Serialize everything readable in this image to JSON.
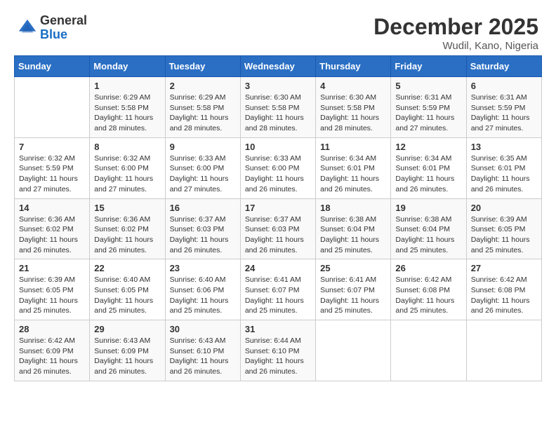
{
  "header": {
    "logo_general": "General",
    "logo_blue": "Blue",
    "month_year": "December 2025",
    "location": "Wudil, Kano, Nigeria"
  },
  "calendar": {
    "days_of_week": [
      "Sunday",
      "Monday",
      "Tuesday",
      "Wednesday",
      "Thursday",
      "Friday",
      "Saturday"
    ],
    "weeks": [
      [
        {
          "day": "",
          "info": ""
        },
        {
          "day": "1",
          "info": "Sunrise: 6:29 AM\nSunset: 5:58 PM\nDaylight: 11 hours\nand 28 minutes."
        },
        {
          "day": "2",
          "info": "Sunrise: 6:29 AM\nSunset: 5:58 PM\nDaylight: 11 hours\nand 28 minutes."
        },
        {
          "day": "3",
          "info": "Sunrise: 6:30 AM\nSunset: 5:58 PM\nDaylight: 11 hours\nand 28 minutes."
        },
        {
          "day": "4",
          "info": "Sunrise: 6:30 AM\nSunset: 5:58 PM\nDaylight: 11 hours\nand 28 minutes."
        },
        {
          "day": "5",
          "info": "Sunrise: 6:31 AM\nSunset: 5:59 PM\nDaylight: 11 hours\nand 27 minutes."
        },
        {
          "day": "6",
          "info": "Sunrise: 6:31 AM\nSunset: 5:59 PM\nDaylight: 11 hours\nand 27 minutes."
        }
      ],
      [
        {
          "day": "7",
          "info": "Sunrise: 6:32 AM\nSunset: 5:59 PM\nDaylight: 11 hours\nand 27 minutes."
        },
        {
          "day": "8",
          "info": "Sunrise: 6:32 AM\nSunset: 6:00 PM\nDaylight: 11 hours\nand 27 minutes."
        },
        {
          "day": "9",
          "info": "Sunrise: 6:33 AM\nSunset: 6:00 PM\nDaylight: 11 hours\nand 27 minutes."
        },
        {
          "day": "10",
          "info": "Sunrise: 6:33 AM\nSunset: 6:00 PM\nDaylight: 11 hours\nand 26 minutes."
        },
        {
          "day": "11",
          "info": "Sunrise: 6:34 AM\nSunset: 6:01 PM\nDaylight: 11 hours\nand 26 minutes."
        },
        {
          "day": "12",
          "info": "Sunrise: 6:34 AM\nSunset: 6:01 PM\nDaylight: 11 hours\nand 26 minutes."
        },
        {
          "day": "13",
          "info": "Sunrise: 6:35 AM\nSunset: 6:01 PM\nDaylight: 11 hours\nand 26 minutes."
        }
      ],
      [
        {
          "day": "14",
          "info": "Sunrise: 6:36 AM\nSunset: 6:02 PM\nDaylight: 11 hours\nand 26 minutes."
        },
        {
          "day": "15",
          "info": "Sunrise: 6:36 AM\nSunset: 6:02 PM\nDaylight: 11 hours\nand 26 minutes."
        },
        {
          "day": "16",
          "info": "Sunrise: 6:37 AM\nSunset: 6:03 PM\nDaylight: 11 hours\nand 26 minutes."
        },
        {
          "day": "17",
          "info": "Sunrise: 6:37 AM\nSunset: 6:03 PM\nDaylight: 11 hours\nand 26 minutes."
        },
        {
          "day": "18",
          "info": "Sunrise: 6:38 AM\nSunset: 6:04 PM\nDaylight: 11 hours\nand 25 minutes."
        },
        {
          "day": "19",
          "info": "Sunrise: 6:38 AM\nSunset: 6:04 PM\nDaylight: 11 hours\nand 25 minutes."
        },
        {
          "day": "20",
          "info": "Sunrise: 6:39 AM\nSunset: 6:05 PM\nDaylight: 11 hours\nand 25 minutes."
        }
      ],
      [
        {
          "day": "21",
          "info": "Sunrise: 6:39 AM\nSunset: 6:05 PM\nDaylight: 11 hours\nand 25 minutes."
        },
        {
          "day": "22",
          "info": "Sunrise: 6:40 AM\nSunset: 6:05 PM\nDaylight: 11 hours\nand 25 minutes."
        },
        {
          "day": "23",
          "info": "Sunrise: 6:40 AM\nSunset: 6:06 PM\nDaylight: 11 hours\nand 25 minutes."
        },
        {
          "day": "24",
          "info": "Sunrise: 6:41 AM\nSunset: 6:07 PM\nDaylight: 11 hours\nand 25 minutes."
        },
        {
          "day": "25",
          "info": "Sunrise: 6:41 AM\nSunset: 6:07 PM\nDaylight: 11 hours\nand 25 minutes."
        },
        {
          "day": "26",
          "info": "Sunrise: 6:42 AM\nSunset: 6:08 PM\nDaylight: 11 hours\nand 25 minutes."
        },
        {
          "day": "27",
          "info": "Sunrise: 6:42 AM\nSunset: 6:08 PM\nDaylight: 11 hours\nand 26 minutes."
        }
      ],
      [
        {
          "day": "28",
          "info": "Sunrise: 6:42 AM\nSunset: 6:09 PM\nDaylight: 11 hours\nand 26 minutes."
        },
        {
          "day": "29",
          "info": "Sunrise: 6:43 AM\nSunset: 6:09 PM\nDaylight: 11 hours\nand 26 minutes."
        },
        {
          "day": "30",
          "info": "Sunrise: 6:43 AM\nSunset: 6:10 PM\nDaylight: 11 hours\nand 26 minutes."
        },
        {
          "day": "31",
          "info": "Sunrise: 6:44 AM\nSunset: 6:10 PM\nDaylight: 11 hours\nand 26 minutes."
        },
        {
          "day": "",
          "info": ""
        },
        {
          "day": "",
          "info": ""
        },
        {
          "day": "",
          "info": ""
        }
      ]
    ]
  }
}
